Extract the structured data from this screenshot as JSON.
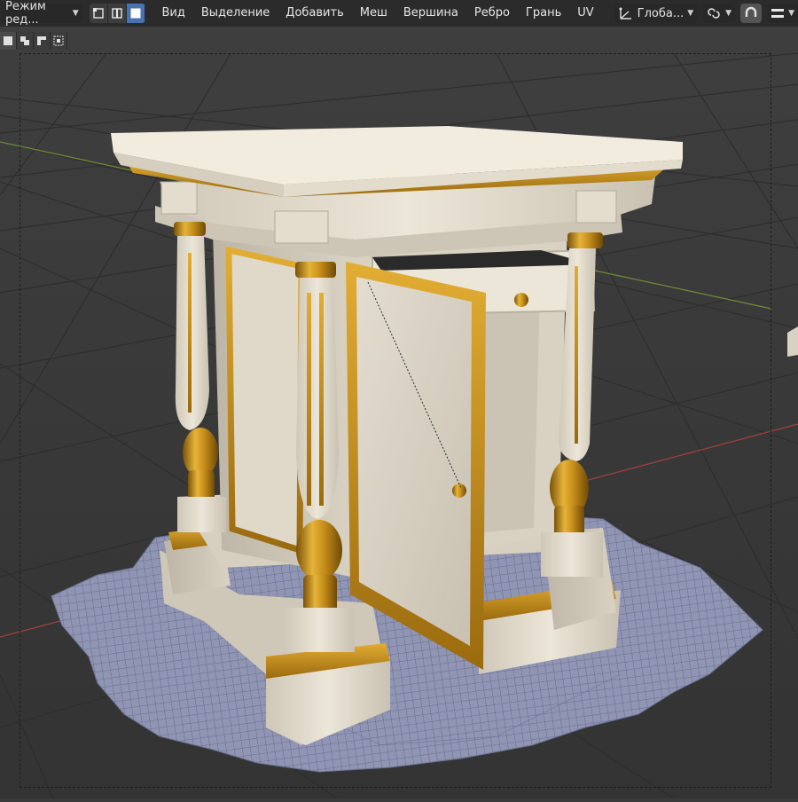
{
  "header": {
    "mode_dropdown": "Режим ред...",
    "menu": [
      "Вид",
      "Выделение",
      "Добавить",
      "Меш",
      "Вершина",
      "Ребро",
      "Грань",
      "UV"
    ],
    "orientation_dropdown": "Глоба...",
    "select_modes": [
      "vertex-select",
      "edge-select",
      "face-select"
    ],
    "active_select_mode": "face-select"
  },
  "colors": {
    "accent": "#4772b3",
    "header_bg": "#2b2b2b",
    "viewport_bg": "#3a3a3a",
    "gold": "#c8901a",
    "cream": "#e6dfcf",
    "grid_x_axis": "#b04a4a",
    "grid_y_axis": "#7c9a3a",
    "cloth": "#8e93b2"
  },
  "viewport": {
    "object": "tabernacle-cabinet",
    "ground_object": "cloth-mesh"
  }
}
